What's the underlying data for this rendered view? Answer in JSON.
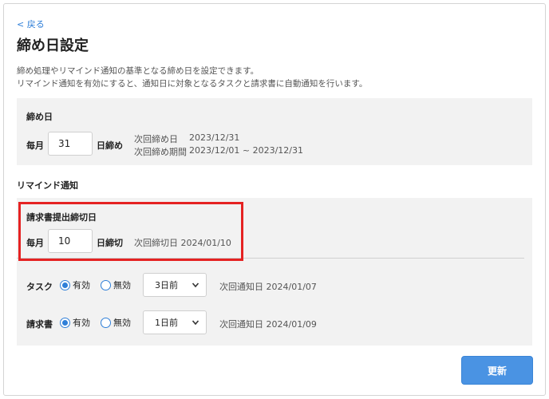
{
  "nav": {
    "back_label": "< 戻る"
  },
  "page": {
    "title": "締め日設定",
    "description_line1": "締め処理やリマインド通知の基準となる締め日を設定できます。",
    "description_line2": "リマインド通知を有効にすると、通知日に対象となるタスクと請求書に自動通知を行います。"
  },
  "deadline": {
    "heading": "締め日",
    "prefix": "毎月",
    "day_value": "31",
    "suffix": "日締め",
    "next_date_label": "次回締め日",
    "next_date_value": "2023/12/31",
    "next_period_label": "次回締め期間",
    "next_period_value": "2023/12/01 ~ 2023/12/31"
  },
  "remind": {
    "heading": "リマインド通知",
    "invoice_deadline": {
      "heading": "請求書提出締切日",
      "prefix": "毎月",
      "day_value": "10",
      "suffix": "日締切",
      "next_label": "次回締切日 2024/01/10"
    },
    "rows": [
      {
        "label": "タスク",
        "enabled_label": "有効",
        "disabled_label": "無効",
        "selected": "enabled",
        "select_value": "3日前",
        "next_notify": "次回通知日 2024/01/07"
      },
      {
        "label": "請求書",
        "enabled_label": "有効",
        "disabled_label": "無効",
        "selected": "enabled",
        "select_value": "1日前",
        "next_notify": "次回通知日 2024/01/09"
      }
    ]
  },
  "actions": {
    "update_label": "更新"
  },
  "colors": {
    "accent": "#2f7fd8",
    "button": "#4a93e3",
    "highlight": "#e52222",
    "panel": "#f2f2f2"
  },
  "icons": {
    "select_indicator": "chevron-down-icon"
  }
}
